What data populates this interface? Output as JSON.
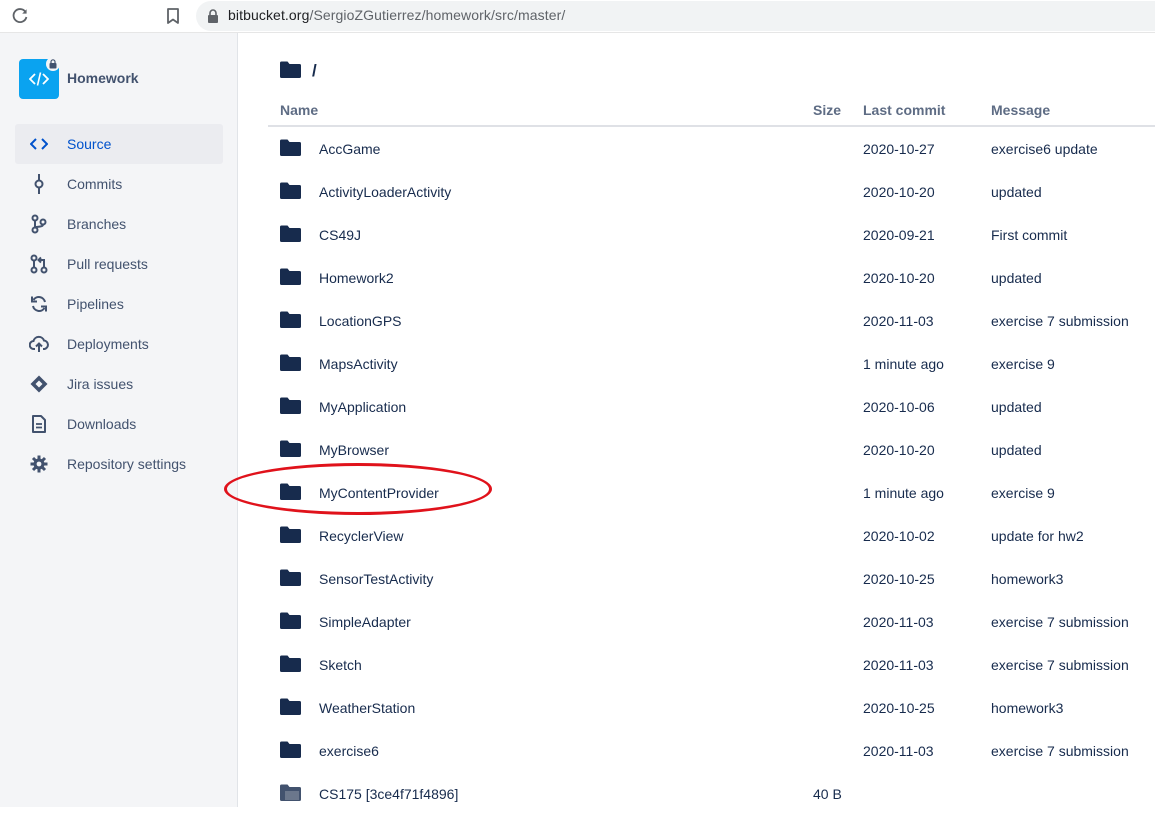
{
  "browser": {
    "url_host": "bitbucket.org",
    "url_path": "/SergioZGutierrez/homework/src/master/",
    "reload_icon": "reload-icon",
    "bookmark_icon": "bookmark-icon",
    "lock_icon": "lock-icon"
  },
  "sidebar": {
    "repo_name": "Homework",
    "repo_avatar_icon": "code-icon",
    "private_icon": "lock-icon",
    "items": [
      {
        "label": "Source",
        "icon": "source-code-icon",
        "active": true
      },
      {
        "label": "Commits",
        "icon": "commit-icon",
        "active": false
      },
      {
        "label": "Branches",
        "icon": "branch-icon",
        "active": false
      },
      {
        "label": "Pull requests",
        "icon": "pull-request-icon",
        "active": false
      },
      {
        "label": "Pipelines",
        "icon": "pipeline-icon",
        "active": false
      },
      {
        "label": "Deployments",
        "icon": "deployment-cloud-icon",
        "active": false
      },
      {
        "label": "Jira issues",
        "icon": "jira-icon",
        "active": false
      },
      {
        "label": "Downloads",
        "icon": "document-icon",
        "active": false
      },
      {
        "label": "Repository settings",
        "icon": "gear-icon",
        "active": false
      }
    ]
  },
  "main": {
    "path": "/",
    "columns": {
      "name": "Name",
      "size": "Size",
      "last_commit": "Last commit",
      "message": "Message"
    },
    "rows": [
      {
        "name": "AccGame",
        "size": "",
        "date": "2020-10-27",
        "message": "exercise6 update",
        "icon": "folder-icon"
      },
      {
        "name": "ActivityLoaderActivity",
        "size": "",
        "date": "2020-10-20",
        "message": "updated",
        "icon": "folder-icon"
      },
      {
        "name": "CS49J",
        "size": "",
        "date": "2020-09-21",
        "message": "First commit",
        "icon": "folder-icon"
      },
      {
        "name": "Homework2",
        "size": "",
        "date": "2020-10-20",
        "message": "updated",
        "icon": "folder-icon"
      },
      {
        "name": "LocationGPS",
        "size": "",
        "date": "2020-11-03",
        "message": "exercise 7 submission",
        "icon": "folder-icon"
      },
      {
        "name": "MapsActivity",
        "size": "",
        "date": "1 minute ago",
        "message": "exercise 9",
        "icon": "folder-icon"
      },
      {
        "name": "MyApplication",
        "size": "",
        "date": "2020-10-06",
        "message": "updated",
        "icon": "folder-icon"
      },
      {
        "name": "MyBrowser",
        "size": "",
        "date": "2020-10-20",
        "message": "updated",
        "icon": "folder-icon"
      },
      {
        "name": "MyContentProvider",
        "size": "",
        "date": "1 minute ago",
        "message": "exercise 9",
        "icon": "folder-icon",
        "highlighted": true
      },
      {
        "name": "RecyclerView",
        "size": "",
        "date": "2020-10-02",
        "message": "update for hw2",
        "icon": "folder-icon"
      },
      {
        "name": "SensorTestActivity",
        "size": "",
        "date": "2020-10-25",
        "message": "homework3",
        "icon": "folder-icon"
      },
      {
        "name": "SimpleAdapter",
        "size": "",
        "date": "2020-11-03",
        "message": "exercise 7 submission",
        "icon": "folder-icon"
      },
      {
        "name": "Sketch",
        "size": "",
        "date": "2020-11-03",
        "message": "exercise 7 submission",
        "icon": "folder-icon"
      },
      {
        "name": "WeatherStation",
        "size": "",
        "date": "2020-10-25",
        "message": "homework3",
        "icon": "folder-icon"
      },
      {
        "name": "exercise6",
        "size": "",
        "date": "2020-11-03",
        "message": "exercise 7 submission",
        "icon": "folder-icon"
      },
      {
        "name": "CS175 [3ce4f71f4896]",
        "size": "40 B",
        "date": "",
        "message": "",
        "icon": "submodule-folder-icon"
      }
    ]
  },
  "colors": {
    "accent": "#0052CC",
    "avatar": "#0AA3F0",
    "folder": "#172B4D",
    "sidebar_bg": "#F4F5F7",
    "annotation": "#E0121B"
  }
}
